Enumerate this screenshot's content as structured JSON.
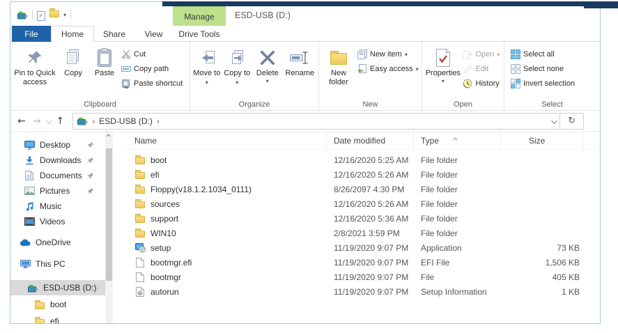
{
  "colors": {
    "accent_blue": "#1e63a8",
    "manage_green": "#bde28e",
    "selection_gray": "#d9d9d9",
    "folder_yellow": "#edc95b",
    "window_border": "#a8c8de",
    "behind_window_navy": "#1b3a60"
  },
  "window": {
    "title": "ESD-USB (D:)",
    "contextual_header": "Manage"
  },
  "tabs": [
    {
      "label": "File"
    },
    {
      "label": "Home"
    },
    {
      "label": "Share"
    },
    {
      "label": "View"
    },
    {
      "label": "Drive Tools"
    }
  ],
  "ribbon": {
    "clipboard": {
      "label": "Clipboard",
      "pin": "Pin to Quick access",
      "copy": "Copy",
      "paste": "Paste",
      "cut": "Cut",
      "copy_path": "Copy path",
      "paste_shortcut": "Paste shortcut"
    },
    "organize": {
      "label": "Organize",
      "move_to": "Move to",
      "copy_to": "Copy to",
      "delete": "Delete",
      "rename": "Rename"
    },
    "new_group": {
      "label": "New",
      "new_folder": "New folder",
      "new_item": "New item",
      "easy_access": "Easy access"
    },
    "open_group": {
      "label": "Open",
      "properties": "Properties",
      "open": "Open",
      "edit": "Edit",
      "history": "History"
    },
    "select_group": {
      "label": "Select",
      "select_all": "Select all",
      "select_none": "Select none",
      "invert_selection": "Invert selection"
    }
  },
  "address_bar": {
    "crumb": "ESD-USB (D:)"
  },
  "sidebar": {
    "items": [
      {
        "label": "Desktop",
        "icon": "desktop-icon",
        "pinned": true,
        "indent": 19,
        "gap": 0,
        "selected": false
      },
      {
        "label": "Downloads",
        "icon": "downloads-icon",
        "pinned": true,
        "indent": 19,
        "gap": 0,
        "selected": false
      },
      {
        "label": "Documents",
        "icon": "documents-icon",
        "pinned": true,
        "indent": 19,
        "gap": 0,
        "selected": false
      },
      {
        "label": "Pictures",
        "icon": "pictures-icon",
        "pinned": true,
        "indent": 19,
        "gap": 0,
        "selected": false
      },
      {
        "label": "Music",
        "icon": "music-icon",
        "pinned": false,
        "indent": 19,
        "gap": 0,
        "selected": false
      },
      {
        "label": "Videos",
        "icon": "videos-icon",
        "pinned": false,
        "indent": 19,
        "gap": 0,
        "selected": false
      },
      {
        "label": "OneDrive",
        "icon": "onedrive-icon",
        "pinned": false,
        "indent": 13,
        "gap": 8,
        "selected": false
      },
      {
        "label": "This PC",
        "icon": "thispc-icon",
        "pinned": false,
        "indent": 13,
        "gap": 9,
        "selected": false
      },
      {
        "label": "ESD-USB (D:)",
        "icon": "usb-drive-icon",
        "pinned": false,
        "indent": 24,
        "gap": 12,
        "selected": true
      },
      {
        "label": "boot",
        "icon": "folder-icon",
        "pinned": false,
        "indent": 34,
        "gap": 2,
        "selected": false
      },
      {
        "label": "efi",
        "icon": "folder-icon",
        "pinned": false,
        "indent": 34,
        "gap": 2,
        "selected": false
      }
    ]
  },
  "file_list": {
    "columns": [
      {
        "label": "Name"
      },
      {
        "label": "Date modified"
      },
      {
        "label": "Type",
        "sorted": "asc"
      },
      {
        "label": "Size"
      }
    ],
    "rows": [
      {
        "name": "boot",
        "icon": "folder-icon",
        "date": "12/16/2020 5:25 AM",
        "type": "File folder",
        "size": ""
      },
      {
        "name": "efi",
        "icon": "folder-icon",
        "date": "12/16/2020 5:26 AM",
        "type": "File folder",
        "size": ""
      },
      {
        "name": "Floppy(v18.1.2.1034_0111)",
        "icon": "folder-icon",
        "date": "8/26/2097 4:30 PM",
        "type": "File folder",
        "size": ""
      },
      {
        "name": "sources",
        "icon": "folder-icon",
        "date": "12/16/2020 5:26 AM",
        "type": "File folder",
        "size": ""
      },
      {
        "name": "support",
        "icon": "folder-icon",
        "date": "12/16/2020 5:36 AM",
        "type": "File folder",
        "size": ""
      },
      {
        "name": "WIN10",
        "icon": "folder-icon",
        "date": "2/8/2021 3:59 PM",
        "type": "File folder",
        "size": ""
      },
      {
        "name": "setup",
        "icon": "application-icon",
        "date": "11/19/2020 9:07 PM",
        "type": "Application",
        "size": "73 KB"
      },
      {
        "name": "bootmgr.efi",
        "icon": "file-icon",
        "date": "11/19/2020 9:07 PM",
        "type": "EFI File",
        "size": "1,506 KB"
      },
      {
        "name": "bootmgr",
        "icon": "file-icon",
        "date": "11/19/2020 9:07 PM",
        "type": "File",
        "size": "405 KB"
      },
      {
        "name": "autorun",
        "icon": "setup-info-icon",
        "date": "11/19/2020 9:07 PM",
        "type": "Setup Information",
        "size": "1 KB"
      }
    ]
  }
}
